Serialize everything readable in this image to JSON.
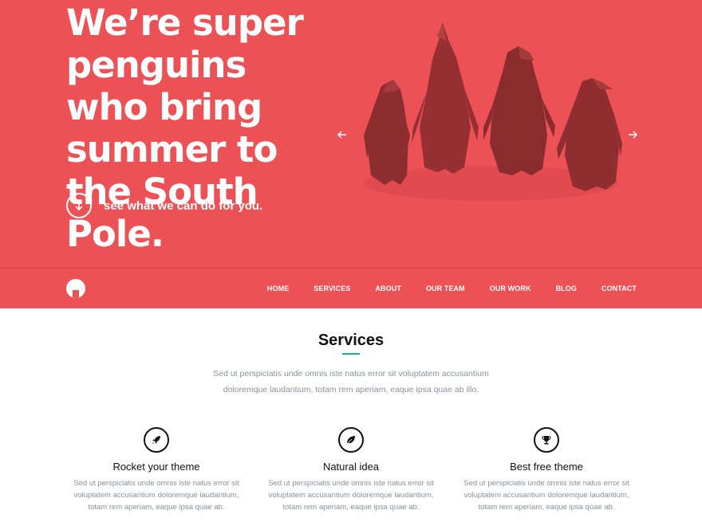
{
  "hero": {
    "headline": "We’re super penguins who bring summer to the South Pole.",
    "cta_label": "see what we can do for you.",
    "cta_icon": "arrow-down-icon",
    "prev_icon": "arrow-left-icon",
    "next_icon": "arrow-right-icon",
    "background_color": "#ec5156"
  },
  "nav": {
    "logo_icon": "logo-icon",
    "items": [
      "HOME",
      "SERVICES",
      "ABOUT",
      "OUR TEAM",
      "OUR WORK",
      "BLOG",
      "CONTACT"
    ]
  },
  "services": {
    "title": "Services",
    "accent_color": "#1eb08a",
    "intro": "Sed ut perspiciatis unde omnis iste natus error sit voluptatem accusantium doloremque laudantium, totam rem aperiam, eaque ipsa quae ab illo.",
    "cards": [
      {
        "icon": "rocket-icon",
        "title": "Rocket your theme",
        "text": "Sed ut perspiciatis unde omnis iste natus error sit voluptatem accusantium doloremque laudantium, totam rem aperiam, eaque ipsa quae ab."
      },
      {
        "icon": "leaf-icon",
        "title": "Natural idea",
        "text": "Sed ut perspiciatis unde omnis iste natus error sit voluptatem accusantium doloremque laudantium, totam rem aperiam, eaque ipsa quae ab."
      },
      {
        "icon": "trophy-icon",
        "title": "Best free theme",
        "text": "Sed ut perspiciatis unde omnis iste natus error sit voluptatem accusantium doloremque laudantium, totam rem aperiam, eaque ipsa quae ab."
      }
    ]
  }
}
